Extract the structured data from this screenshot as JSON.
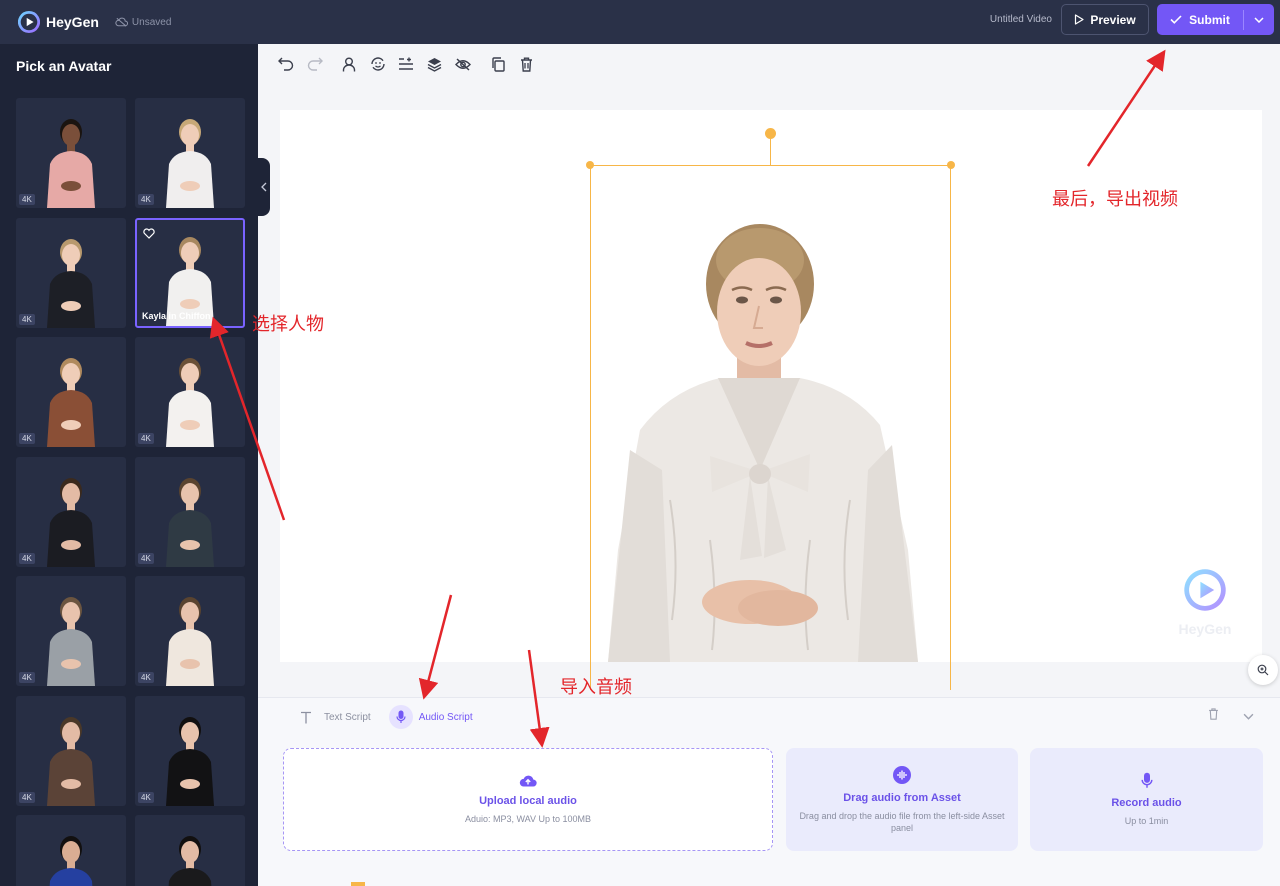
{
  "app": {
    "name": "HeyGen",
    "save_status": "Unsaved"
  },
  "header": {
    "video_title": "Untitled Video",
    "preview_label": "Preview",
    "submit_label": "Submit"
  },
  "sidebar": {
    "title": "Pick an Avatar",
    "badge": "4K",
    "selected_name": "Kayla in Chiffon"
  },
  "toolbar": {
    "tools": [
      "undo-icon",
      "redo-icon",
      "avatar-icon",
      "expression-icon",
      "align-icon",
      "layers-icon",
      "hide-icon",
      "duplicate-icon",
      "trash-icon"
    ]
  },
  "canvas": {
    "watermark": "HeyGen"
  },
  "script_panel": {
    "tabs": [
      {
        "label": "Text Script",
        "active": false
      },
      {
        "label": "Audio Script",
        "active": true
      }
    ],
    "cards": {
      "upload": {
        "title": "Upload local audio",
        "subtitle": "Aduio: MP3, WAV Up to 100MB"
      },
      "asset": {
        "title": "Drag audio from Asset",
        "subtitle": "Drag and drop the audio file from the left-side Asset panel"
      },
      "record": {
        "title": "Record audio",
        "subtitle": "Up to 1min"
      }
    }
  },
  "annotations": {
    "export": "最后，导出视频",
    "select_avatar": "选择人物",
    "import_audio": "导入音频"
  },
  "colors": {
    "accent": "#7357f6",
    "topbar": "#2a3148",
    "sidebar": "#1e2437",
    "selection": "#f7b648",
    "annotation": "#e3262b"
  }
}
